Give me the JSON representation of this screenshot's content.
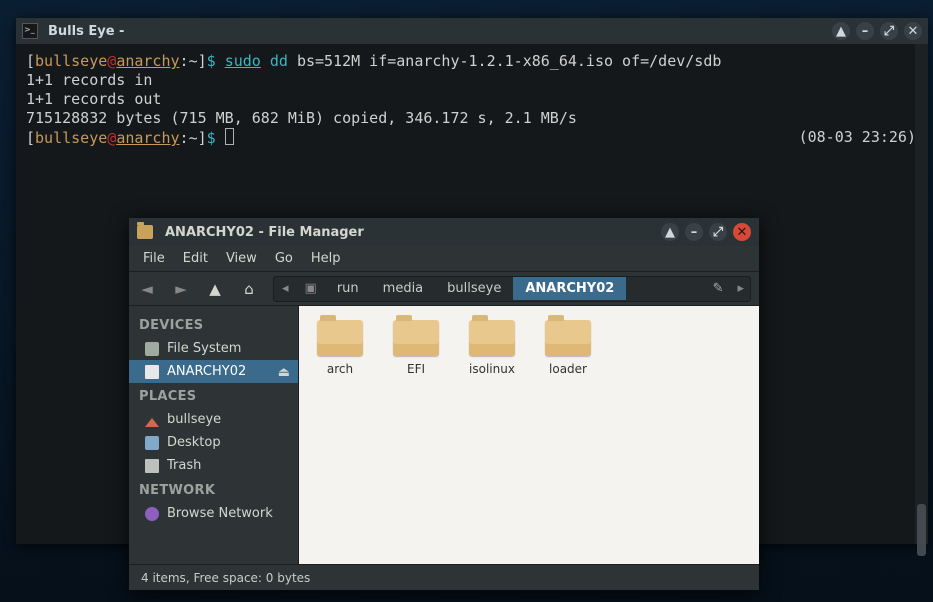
{
  "terminal": {
    "title": "Bulls Eye -",
    "prompt": {
      "user": "bullseye",
      "host": "anarchy",
      "path": "~",
      "bracket_open": "[",
      "bracket_close": "]",
      "at": "@",
      "sep": ":",
      "dollar": "$"
    },
    "cmd": {
      "sudo": "sudo",
      "dd": "dd",
      "args": "bs=512M if=anarchy-1.2.1-x86_64.iso of=/dev/sdb"
    },
    "output1": "1+1 records in",
    "output2": "1+1 records out",
    "output3": "715128832 bytes (715 MB, 682 MiB) copied, 346.172 s, 2.1 MB/s",
    "clock": "(08-03 23:26)"
  },
  "fm": {
    "title": "ANARCHY02 - File Manager",
    "menu": {
      "file": "File",
      "edit": "Edit",
      "view": "View",
      "go": "Go",
      "help": "Help"
    },
    "path": {
      "run": "run",
      "media": "media",
      "user": "bullseye",
      "vol": "ANARCHY02"
    },
    "side": {
      "hdr_devices": "DEVICES",
      "filesystem": "File System",
      "volume": "ANARCHY02",
      "hdr_places": "PLACES",
      "home": "bullseye",
      "desktop": "Desktop",
      "trash": "Trash",
      "hdr_network": "NETWORK",
      "browse": "Browse Network"
    },
    "folders": {
      "arch": "arch",
      "efi": "EFI",
      "isolinux": "isolinux",
      "loader": "loader"
    },
    "status": "4 items, Free space: 0 bytes"
  }
}
